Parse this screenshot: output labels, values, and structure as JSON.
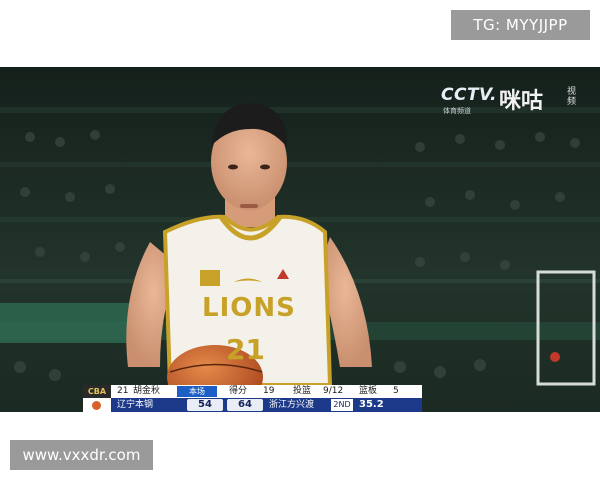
{
  "watermarks": {
    "top_right": "TG: MYYJJPP",
    "bottom_left": "www.vxxdr.com"
  },
  "broadcast": {
    "cctv": "CCTV.",
    "cctv_sub": "体育频道",
    "migu": "咪咕",
    "migu_sub": "视频"
  },
  "jersey": {
    "wordmark": "LIONS",
    "number": "21"
  },
  "scorebug": {
    "player_number": "21",
    "player_name": "胡金秋",
    "tag": "本场",
    "stat1_label": "得分",
    "stat1_value": "19",
    "stat2_label": "投篮",
    "stat2_value": "9/12",
    "stat3_label": "篮板",
    "stat3_value": "5",
    "home_team": "辽宁本钢",
    "home_score": "54",
    "away_score": "64",
    "away_team": "浙江方兴渡",
    "period": "2ND",
    "clock": "35.2"
  },
  "colors": {
    "jersey_gold": "#c8a128",
    "scorebug_blue": "#1d3a8a",
    "badge_gray": "#9a9a9a"
  }
}
